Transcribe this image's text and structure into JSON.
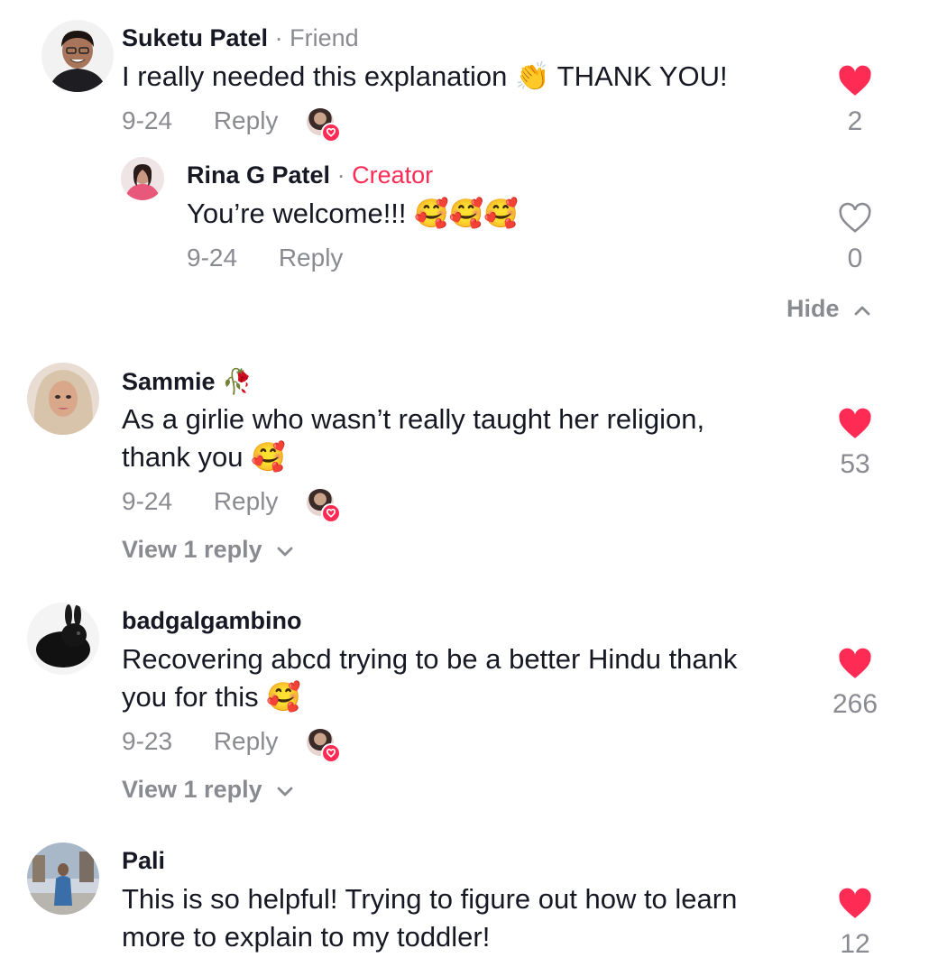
{
  "comments": [
    {
      "username": "Suketu Patel",
      "separator": "·",
      "tag": "Friend",
      "text": "I really needed this explanation 👏 THANK YOU!",
      "date": "9-24",
      "reply_label": "Reply",
      "likes": "2",
      "liked": true
    },
    {
      "username": "Rina G Patel",
      "separator": "·",
      "tag": "Creator",
      "text": "You’re welcome!!! 🥰🥰🥰",
      "date": "9-24",
      "reply_label": "Reply",
      "likes": "0",
      "liked": false
    },
    {
      "username": "Sammie 🥀",
      "text_line1": "As a girlie who wasn’t really taught her religion,",
      "text_line2": "thank you 🥰",
      "date": "9-24",
      "reply_label": "Reply",
      "likes": "53",
      "liked": true,
      "view_replies": "View 1 reply"
    },
    {
      "username": "badgalgambino",
      "text_line1": "Recovering abcd trying to be a better Hindu thank",
      "text_line2": "you for this 🥰",
      "date": "9-23",
      "reply_label": "Reply",
      "likes": "266",
      "liked": true,
      "view_replies": "View 1 reply"
    },
    {
      "username": "Pali",
      "text_line1": "This is so helpful! Trying to figure out how to learn",
      "text_line2": "more to explain to my toddler!",
      "likes": "12",
      "liked": true
    }
  ],
  "hide_label": "Hide",
  "colors": {
    "heart_filled": "#fe2c55",
    "creator_tag": "#fe2c55",
    "muted": "#8a8b91",
    "text": "#161823"
  },
  "icons": {
    "like_filled": "heart-filled-icon",
    "like_outline": "heart-outline-icon",
    "expand": "chevron-down-icon",
    "collapse": "chevron-up-icon"
  }
}
